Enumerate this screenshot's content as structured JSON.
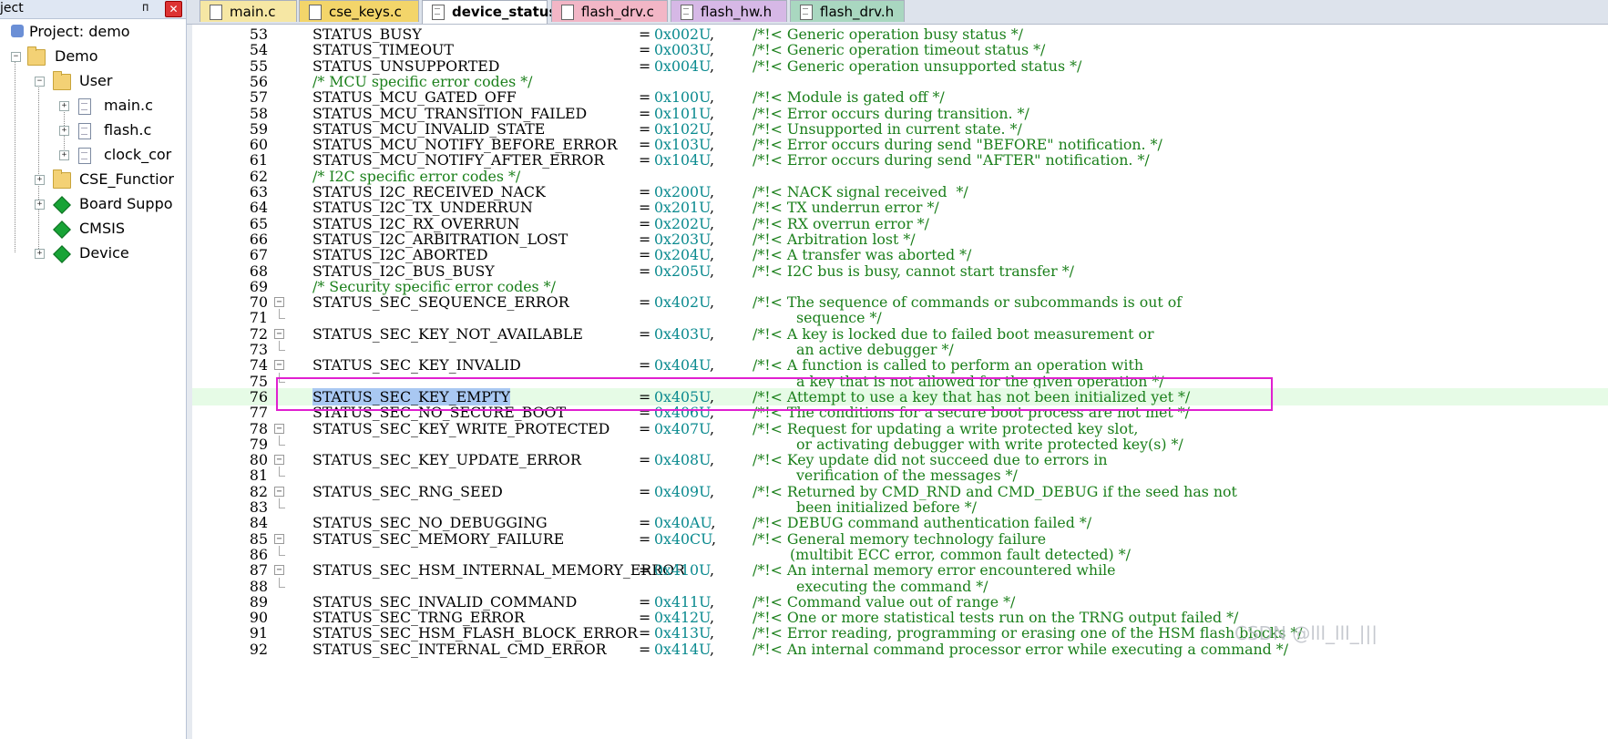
{
  "project_panel": {
    "title": "ject",
    "close_glyph": "✕",
    "pin_glyph": "ᴨ",
    "tree": [
      {
        "label": "Project: demo",
        "icon": "project-icon"
      },
      {
        "label": "Demo",
        "icon": "target-folder-icon",
        "expand": "−"
      },
      {
        "label": "User",
        "icon": "folder-icon",
        "expand": "−"
      },
      {
        "label": "main.c",
        "icon": "file-icon",
        "expand": "+"
      },
      {
        "label": "flash.c",
        "icon": "file-icon",
        "expand": "+"
      },
      {
        "label": "clock_cor",
        "icon": "file-icon",
        "expand": "+"
      },
      {
        "label": "CSE_Functior",
        "icon": "folder-icon",
        "expand": "+"
      },
      {
        "label": "Board Suppo",
        "icon": "component-icon",
        "expand": "+"
      },
      {
        "label": "CMSIS",
        "icon": "component-icon",
        "expand": ""
      },
      {
        "label": "Device",
        "icon": "component-icon",
        "expand": "+"
      }
    ]
  },
  "tabs": [
    {
      "label": "main.c",
      "color": "#f6e7a4",
      "active": false
    },
    {
      "label": "cse_keys.c",
      "color": "#f3d56a",
      "active": false
    },
    {
      "label": "device_status.h",
      "color": "#ffffff",
      "active": true
    },
    {
      "label": "flash_drv.c",
      "color": "#f2b6c6",
      "active": false
    },
    {
      "label": "flash_hw.h",
      "color": "#d6b8e6",
      "active": false
    },
    {
      "label": "flash_drv.h",
      "color": "#a9d7c0",
      "active": false
    }
  ],
  "code": [
    {
      "n": "53",
      "id": "STATUS_BUSY",
      "eq": "=",
      "val": "0x002U",
      "cmt": "/*!< Generic operation busy status */"
    },
    {
      "n": "54",
      "id": "STATUS_TIMEOUT",
      "eq": "=",
      "val": "0x003U",
      "cmt": "/*!< Generic operation timeout status */"
    },
    {
      "n": "55",
      "id": "STATUS_UNSUPPORTED",
      "eq": "=",
      "val": "0x004U",
      "cmt": "/*!< Generic operation unsupported status */"
    },
    {
      "n": "56",
      "id": "/* MCU specific error codes */",
      "section": true
    },
    {
      "n": "57",
      "id": "STATUS_MCU_GATED_OFF",
      "eq": "=",
      "val": "0x100U",
      "cmt": "/*!< Module is gated off */"
    },
    {
      "n": "58",
      "id": "STATUS_MCU_TRANSITION_FAILED",
      "eq": "=",
      "val": "0x101U",
      "cmt": "/*!< Error occurs during transition. */"
    },
    {
      "n": "59",
      "id": "STATUS_MCU_INVALID_STATE",
      "eq": "=",
      "val": "0x102U",
      "cmt": "/*!< Unsupported in current state. */"
    },
    {
      "n": "60",
      "id": "STATUS_MCU_NOTIFY_BEFORE_ERROR",
      "eq": "=",
      "val": "0x103U",
      "cmt": "/*!< Error occurs during send \"BEFORE\" notification. */"
    },
    {
      "n": "61",
      "id": "STATUS_MCU_NOTIFY_AFTER_ERROR",
      "eq": "=",
      "val": "0x104U",
      "cmt": "/*!< Error occurs during send \"AFTER\" notification. */"
    },
    {
      "n": "62",
      "id": "/* I2C specific error codes */",
      "section": true
    },
    {
      "n": "63",
      "id": "STATUS_I2C_RECEIVED_NACK",
      "eq": "=",
      "val": "0x200U",
      "cmt": "/*!< NACK signal received  */"
    },
    {
      "n": "64",
      "id": "STATUS_I2C_TX_UNDERRUN",
      "eq": "=",
      "val": "0x201U",
      "cmt": "/*!< TX underrun error */"
    },
    {
      "n": "65",
      "id": "STATUS_I2C_RX_OVERRUN",
      "eq": "=",
      "val": "0x202U",
      "cmt": "/*!< RX overrun error */"
    },
    {
      "n": "66",
      "id": "STATUS_I2C_ARBITRATION_LOST",
      "eq": "=",
      "val": "0x203U",
      "cmt": "/*!< Arbitration lost */"
    },
    {
      "n": "67",
      "id": "STATUS_I2C_ABORTED",
      "eq": "=",
      "val": "0x204U",
      "cmt": "/*!< A transfer was aborted */"
    },
    {
      "n": "68",
      "id": "STATUS_I2C_BUS_BUSY",
      "eq": "=",
      "val": "0x205U",
      "cmt": "/*!< I2C bus is busy, cannot start transfer */"
    },
    {
      "n": "69",
      "id": "/* Security specific error codes */",
      "section": true
    },
    {
      "n": "70",
      "id": "STATUS_SEC_SEQUENCE_ERROR",
      "eq": "=",
      "val": "0x402U",
      "cmt": "/*!< The sequence of commands or subcommands is out of",
      "fold": "start"
    },
    {
      "n": "71",
      "cont": "sequence */",
      "fold": "end"
    },
    {
      "n": "72",
      "id": "STATUS_SEC_KEY_NOT_AVAILABLE",
      "eq": "=",
      "val": "0x403U",
      "cmt": "/*!< A key is locked due to failed boot measurement or",
      "fold": "start"
    },
    {
      "n": "73",
      "cont": "an active debugger */",
      "fold": "end"
    },
    {
      "n": "74",
      "id": "STATUS_SEC_KEY_INVALID",
      "eq": "=",
      "val": "0x404U",
      "cmt": "/*!< A function is called to perform an operation with",
      "fold": "start"
    },
    {
      "n": "75",
      "cont": "a key that is not allowed for the given operation */",
      "fold": "end"
    },
    {
      "n": "76",
      "id": "STATUS_SEC_KEY_EMPTY",
      "eq": "=",
      "val": "0x405U",
      "cmt": "/*!< Attempt to use a key that has not been initialized yet */",
      "current": true
    },
    {
      "n": "77",
      "id": "STATUS_SEC_NO_SECURE_BOOT",
      "eq": "=",
      "val": "0x406U",
      "cmt": "/*!< The conditions for a secure boot process are not met */"
    },
    {
      "n": "78",
      "id": "STATUS_SEC_KEY_WRITE_PROTECTED",
      "eq": "=",
      "val": "0x407U",
      "cmt": "/*!< Request for updating a write protected key slot,",
      "fold": "start"
    },
    {
      "n": "79",
      "cont": "or activating debugger with write protected key(s) */",
      "fold": "end"
    },
    {
      "n": "80",
      "id": "STATUS_SEC_KEY_UPDATE_ERROR",
      "eq": "=",
      "val": "0x408U",
      "cmt": "/*!< Key update did not succeed due to errors in",
      "fold": "start"
    },
    {
      "n": "81",
      "cont": "verification of the messages */",
      "fold": "end"
    },
    {
      "n": "82",
      "id": "STATUS_SEC_RNG_SEED",
      "eq": "=",
      "val": "0x409U",
      "cmt": "/*!< Returned by CMD_RND and CMD_DEBUG if the seed has not",
      "fold": "start"
    },
    {
      "n": "83",
      "cont": "been initialized before */",
      "fold": "end"
    },
    {
      "n": "84",
      "id": "STATUS_SEC_NO_DEBUGGING",
      "eq": "=",
      "val": "0x40AU",
      "cmt": "/*!< DEBUG command authentication failed */"
    },
    {
      "n": "85",
      "id": "STATUS_SEC_MEMORY_FAILURE",
      "eq": "=",
      "val": "0x40CU",
      "cmt": "/*!< General memory technology failure",
      "fold": "start"
    },
    {
      "n": "86",
      "cont": "(multibit ECC error, common fault detected) */",
      "fold": "end",
      "cont_style": "alt"
    },
    {
      "n": "87",
      "id": "STATUS_SEC_HSM_INTERNAL_MEMORY_ERROR",
      "eq": "=",
      "val": "0x410U",
      "cmt": "/*!< An internal memory error encountered while",
      "fold": "start"
    },
    {
      "n": "88",
      "cont": "executing the command */",
      "fold": "end"
    },
    {
      "n": "89",
      "id": "STATUS_SEC_INVALID_COMMAND",
      "eq": "=",
      "val": "0x411U",
      "cmt": "/*!< Command value out of range */"
    },
    {
      "n": "90",
      "id": "STATUS_SEC_TRNG_ERROR",
      "eq": "=",
      "val": "0x412U",
      "cmt": "/*!< One or more statistical tests run on the TRNG output failed */"
    },
    {
      "n": "91",
      "id": "STATUS_SEC_HSM_FLASH_BLOCK_ERROR",
      "eq": "=",
      "val": "0x413U",
      "cmt": "/*!< Error reading, programming or erasing one of the HSM flash blocks */"
    },
    {
      "n": "92",
      "id": "STATUS_SEC_INTERNAL_CMD_ERROR",
      "eq": "=",
      "val": "0x414U",
      "cmt": "/*!< An internal command processor error while executing a command */"
    }
  ],
  "watermark": "CSDN @lll_lll_|||",
  "colors": {
    "hex_value": "#0a8a8f",
    "comment": "#1a7f1a",
    "current_line": "#e6fbe6",
    "selection": "#a9c8f2",
    "highlight_box": "#e020d0"
  }
}
